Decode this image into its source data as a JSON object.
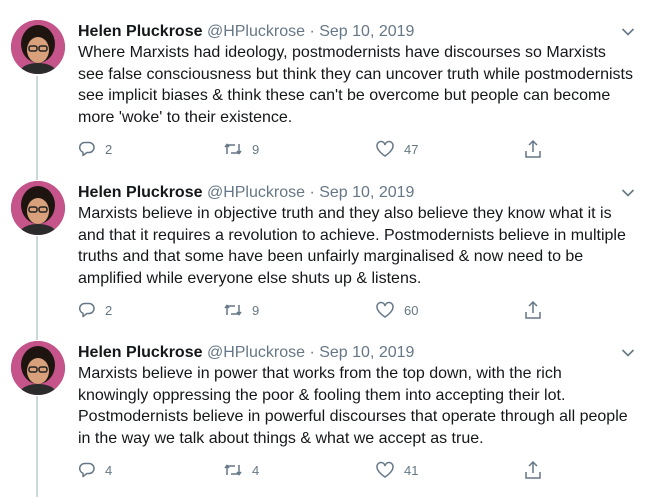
{
  "tweets": [
    {
      "author": "Helen Pluckrose",
      "handle": "@HPluckrose",
      "separator": "·",
      "date": "Sep 10, 2019",
      "text": "Where Marxists had ideology, postmodernists have discourses so Marxists see false consciousness but think they can uncover truth while postmodernists see implicit biases & think these can't be overcome but people can become more 'woke' to their existence.",
      "replies": "2",
      "retweets": "9",
      "likes": "47"
    },
    {
      "author": "Helen Pluckrose",
      "handle": "@HPluckrose",
      "separator": "·",
      "date": "Sep 10, 2019",
      "text": "Marxists believe in objective truth and they also believe they know what it is and that it requires a revolution to achieve. Postmodernists believe in multiple truths and that some have been unfairly marginalised & now need to be amplified while everyone else shuts up & listens.",
      "replies": "2",
      "retweets": "9",
      "likes": "60"
    },
    {
      "author": "Helen Pluckrose",
      "handle": "@HPluckrose",
      "separator": "·",
      "date": "Sep 10, 2019",
      "text": "Marxists believe in power that works from the top down, with the rich knowingly oppressing the poor & fooling them into accepting their lot. Postmodernists believe in powerful discourses that operate through all people in the way we talk about things & what we accept as true.",
      "replies": "4",
      "retweets": "4",
      "likes": "41"
    }
  ],
  "colors": {
    "text": "#14171a",
    "muted": "#657786",
    "thread_line": "#ccd6dd"
  },
  "icons": [
    "reply-icon",
    "retweet-icon",
    "like-icon",
    "share-icon",
    "chevron-down-icon"
  ]
}
